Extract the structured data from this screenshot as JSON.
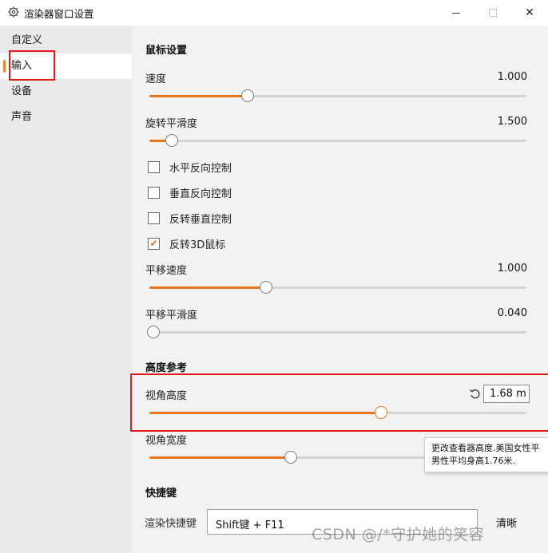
{
  "window": {
    "title": "渲染器窗口设置",
    "minimize_icon": "minimize-icon",
    "maximize_icon": "maximize-icon",
    "close_label": "✕"
  },
  "sidebar": {
    "items": [
      {
        "label": "自定义"
      },
      {
        "label": "输入"
      },
      {
        "label": "设备"
      },
      {
        "label": "声音"
      }
    ],
    "active_index": 1,
    "accent_color": "#e8892c"
  },
  "mouse": {
    "section_title": "鼠标设置",
    "speed": {
      "label": "速度",
      "value": "1.000",
      "fraction": 0.26
    },
    "rotate_smooth": {
      "label": "旋转平滑度",
      "value": "1.500",
      "fraction": 0.06
    },
    "checkboxes": [
      {
        "label": "水平反向控制",
        "checked": false
      },
      {
        "label": "垂直反向控制",
        "checked": false
      },
      {
        "label": "反转垂直控制",
        "checked": false
      },
      {
        "label": "反转3D鼠标",
        "checked": true
      }
    ],
    "pan_speed": {
      "label": "平移速度",
      "value": "1.000",
      "fraction": 0.31
    },
    "pan_smooth": {
      "label": "平移平滑度",
      "value": "0.040",
      "fraction": 0.01
    }
  },
  "height_ref": {
    "section_title": "高度参考",
    "eye_height": {
      "label": "视角高度",
      "value": "1.68  m",
      "fraction": 0.615
    },
    "eye_width": {
      "label": "视角宽度",
      "fraction": 0.375
    },
    "reset_icon": "reset-icon",
    "tooltip_line1": "更改查看器高度.美国女性平",
    "tooltip_line2": "男性平均身高1.76米."
  },
  "shortcut": {
    "section_title": "快捷键",
    "render_label": "渲染快捷键",
    "render_value": "Shift键 + F11",
    "clear_label": "清晰"
  },
  "watermark": "CSDN @/*守护她的笑容",
  "colors": {
    "accent": "#e8761c",
    "highlight_box": "#e01b1b"
  }
}
